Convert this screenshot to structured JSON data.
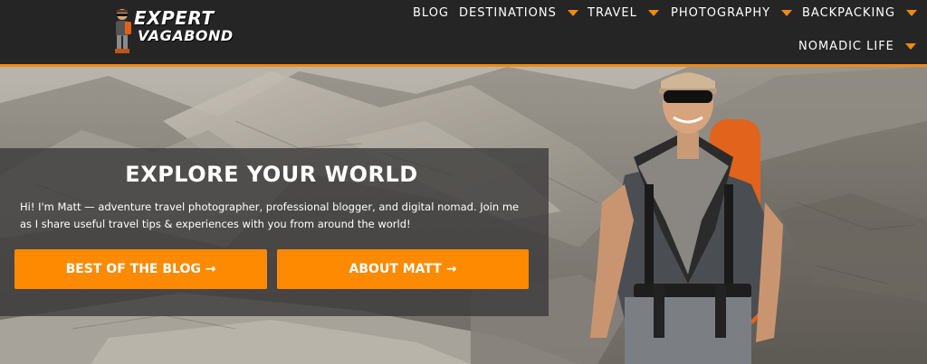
{
  "brand": {
    "line1": "EXPERT",
    "line2": "VAGABOND"
  },
  "nav": {
    "items": [
      {
        "label": "BLOG"
      },
      {
        "label": "DESTINATIONS",
        "has_dropdown": true
      },
      {
        "label": "TRAVEL",
        "has_dropdown": true
      },
      {
        "label": "PHOTOGRAPHY",
        "has_dropdown": true
      },
      {
        "label": "BACKPACKING",
        "has_dropdown": true
      },
      {
        "label": "NOMADIC LIFE",
        "has_dropdown": true
      }
    ],
    "dropdown_icon": "caret-down-icon"
  },
  "hero": {
    "title": "EXPLORE YOUR WORLD",
    "text": "Hi! I'm Matt — adventure travel photographer, professional blogger, and digital nomad. Join me as I share useful travel tips & experiences with you from around the world!",
    "buttons": [
      {
        "label": "BEST OF THE BLOG →"
      },
      {
        "label": "ABOUT MATT →"
      }
    ]
  },
  "colors": {
    "accent": "#fd8a00",
    "header_bg": "#252525",
    "overlay": "#3a3938"
  }
}
